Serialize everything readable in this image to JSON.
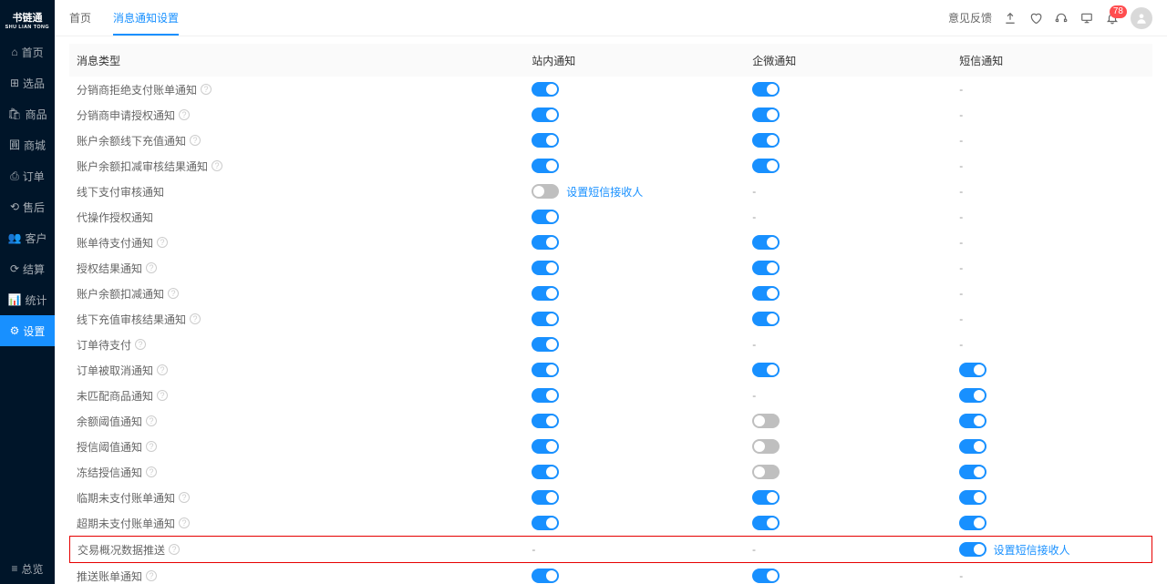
{
  "logo": {
    "title": "书链通",
    "sub": "SHU LIAN TONG"
  },
  "sidebar": {
    "items": [
      {
        "icon": "⌂",
        "label": "首页"
      },
      {
        "icon": "⊞",
        "label": "选品"
      },
      {
        "icon": "🛍",
        "label": "商品"
      },
      {
        "icon": "圓",
        "label": "商城"
      },
      {
        "icon": "⎙",
        "label": "订单"
      },
      {
        "icon": "⟲",
        "label": "售后"
      },
      {
        "icon": "👥",
        "label": "客户"
      },
      {
        "icon": "⟳",
        "label": "结算"
      },
      {
        "icon": "📊",
        "label": "统计"
      },
      {
        "icon": "⚙",
        "label": "设置",
        "active": true
      }
    ],
    "footer": {
      "icon": "≡",
      "label": "总览"
    }
  },
  "header": {
    "tabs": [
      {
        "label": "首页"
      },
      {
        "label": "消息通知设置",
        "active": true
      }
    ],
    "feedback": "意见反馈",
    "badge": "78"
  },
  "table": {
    "headers": {
      "type": "消息类型",
      "site": "站内通知",
      "qw": "企微通知",
      "sms": "短信通知"
    },
    "rows": [
      {
        "name": "分销商拒绝支付账单通知",
        "help": true,
        "site": "on",
        "qw": "on",
        "sms": "dash"
      },
      {
        "name": "分销商申请授权通知",
        "help": true,
        "site": "on",
        "qw": "on",
        "sms": "dash"
      },
      {
        "name": "账户余额线下充值通知",
        "help": true,
        "site": "on",
        "qw": "on",
        "sms": "dash"
      },
      {
        "name": "账户余额扣减审核结果通知",
        "help": true,
        "site": "on",
        "qw": "on",
        "sms": "dash"
      },
      {
        "name": "线下支付审核通知",
        "help": false,
        "site": "off_link",
        "qw": "dash",
        "sms": "dash"
      },
      {
        "name": "代操作授权通知",
        "help": false,
        "site": "on",
        "qw": "dash",
        "sms": "dash"
      },
      {
        "name": "账单待支付通知",
        "help": true,
        "site": "on",
        "qw": "on",
        "sms": "dash"
      },
      {
        "name": "授权结果通知",
        "help": true,
        "site": "on",
        "qw": "on",
        "sms": "dash"
      },
      {
        "name": "账户余额扣减通知",
        "help": true,
        "site": "on",
        "qw": "on",
        "sms": "dash"
      },
      {
        "name": "线下充值审核结果通知",
        "help": true,
        "site": "on",
        "qw": "on",
        "sms": "dash"
      },
      {
        "name": "订单待支付",
        "help": true,
        "site": "on",
        "qw": "dash",
        "sms": "dash"
      },
      {
        "name": "订单被取消通知",
        "help": true,
        "site": "on",
        "qw": "on",
        "sms": "on"
      },
      {
        "name": "未匹配商品通知",
        "help": true,
        "site": "on",
        "qw": "dash",
        "sms": "on"
      },
      {
        "name": "余额阈值通知",
        "help": true,
        "site": "on",
        "qw": "off",
        "sms": "on"
      },
      {
        "name": "授信阈值通知",
        "help": true,
        "site": "on",
        "qw": "off",
        "sms": "on"
      },
      {
        "name": "冻结授信通知",
        "help": true,
        "site": "on",
        "qw": "off",
        "sms": "on"
      },
      {
        "name": "临期未支付账单通知",
        "help": true,
        "site": "on",
        "qw": "on",
        "sms": "on"
      },
      {
        "name": "超期未支付账单通知",
        "help": true,
        "site": "on",
        "qw": "on",
        "sms": "on"
      },
      {
        "name": "交易概况数据推送",
        "help": true,
        "site": "dash",
        "qw": "dash",
        "sms": "on_link",
        "highlight": true
      },
      {
        "name": "推送账单通知",
        "help": true,
        "site": "on",
        "qw": "on",
        "sms": "dash"
      }
    ],
    "recipient_link": "设置短信接收人"
  }
}
